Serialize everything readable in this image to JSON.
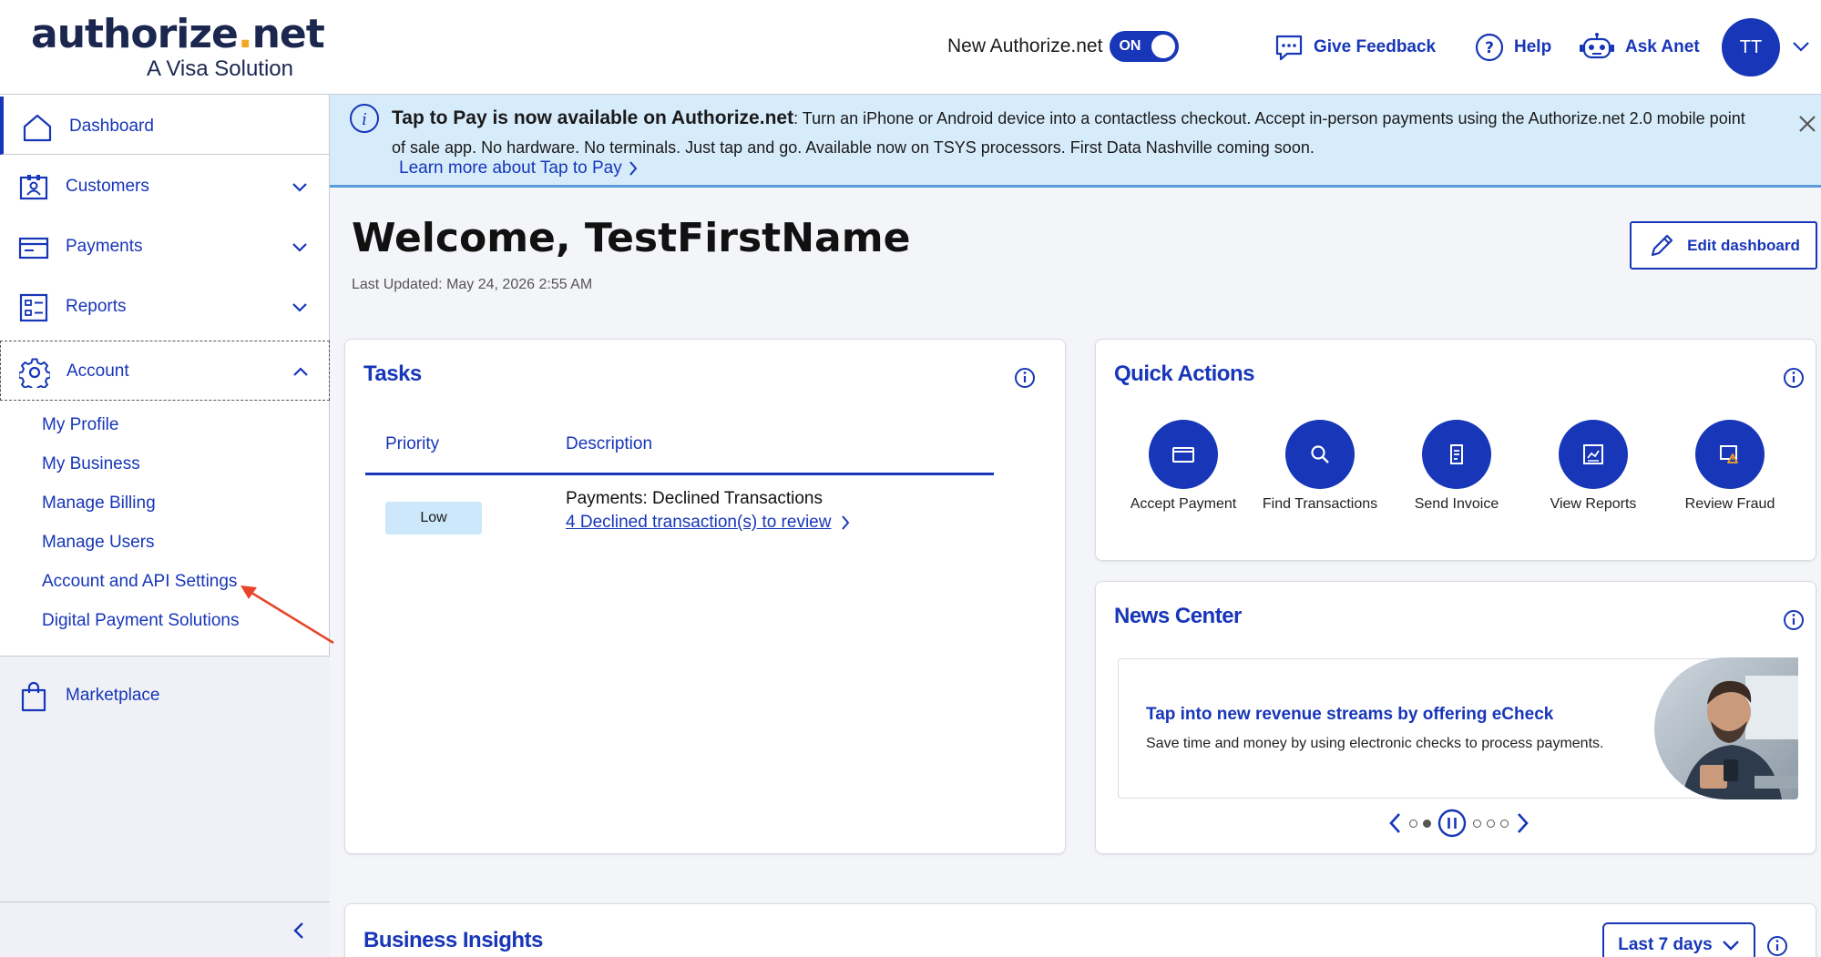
{
  "brand": {
    "logo_main_a": "authorize",
    "logo_dot": ".",
    "logo_main_b": "net",
    "logo_sub": "A Visa Solution"
  },
  "header": {
    "toggle_label": "New Authorize.net",
    "toggle_state": "ON",
    "feedback_label": "Give Feedback",
    "help_label": "Help",
    "ask_label": "Ask Anet",
    "avatar_initials": "TT",
    "accent_color": "#1736b8"
  },
  "sidebar": {
    "items": [
      {
        "label": "Dashboard",
        "icon": "home-icon"
      },
      {
        "label": "Customers",
        "icon": "customer-card-icon"
      },
      {
        "label": "Payments",
        "icon": "payment-card-icon"
      },
      {
        "label": "Reports",
        "icon": "report-list-icon"
      },
      {
        "label": "Account",
        "icon": "gear-icon"
      }
    ],
    "account_sub": [
      "My Profile",
      "My Business",
      "Manage Billing",
      "Manage Users",
      "Account and API Settings",
      "Digital Payment Solutions"
    ],
    "marketplace_label": "Marketplace"
  },
  "banner": {
    "title": "Tap to Pay is now available on Authorize.net",
    "body": ": Turn an iPhone or Android device into a contactless checkout. Accept in-person payments using the Authorize.net 2.0 mobile point of sale app. No hardware. No terminals. Just tap and go. Available now on TSYS processors. First Data Nashville coming soon.",
    "link": "Learn more about Tap to Pay"
  },
  "main": {
    "welcome": "Welcome, TestFirstName",
    "last_updated": "Last Updated: May 24, 2026 2:55 AM",
    "edit_label": "Edit dashboard"
  },
  "tasks": {
    "title": "Tasks",
    "col_priority": "Priority",
    "col_description": "Description",
    "rows": [
      {
        "priority": "Low",
        "title": "Payments: Declined Transactions",
        "link": "4 Declined transaction(s) to review"
      }
    ]
  },
  "quick_actions": {
    "title": "Quick Actions",
    "items": [
      {
        "label": "Accept Payment",
        "icon": "card-terminal-icon"
      },
      {
        "label": "Find Transactions",
        "icon": "search-icon"
      },
      {
        "label": "Send Invoice",
        "icon": "invoice-icon"
      },
      {
        "label": "View Reports",
        "icon": "report-chart-icon"
      },
      {
        "label": "Review Fraud",
        "icon": "fraud-alert-icon"
      }
    ]
  },
  "news": {
    "title": "News Center",
    "headline": "Tap into new revenue streams by offering eCheck",
    "description": "Save time and money by using electronic checks to process payments."
  },
  "insights": {
    "title": "Business Insights",
    "range": "Last 7 days"
  }
}
